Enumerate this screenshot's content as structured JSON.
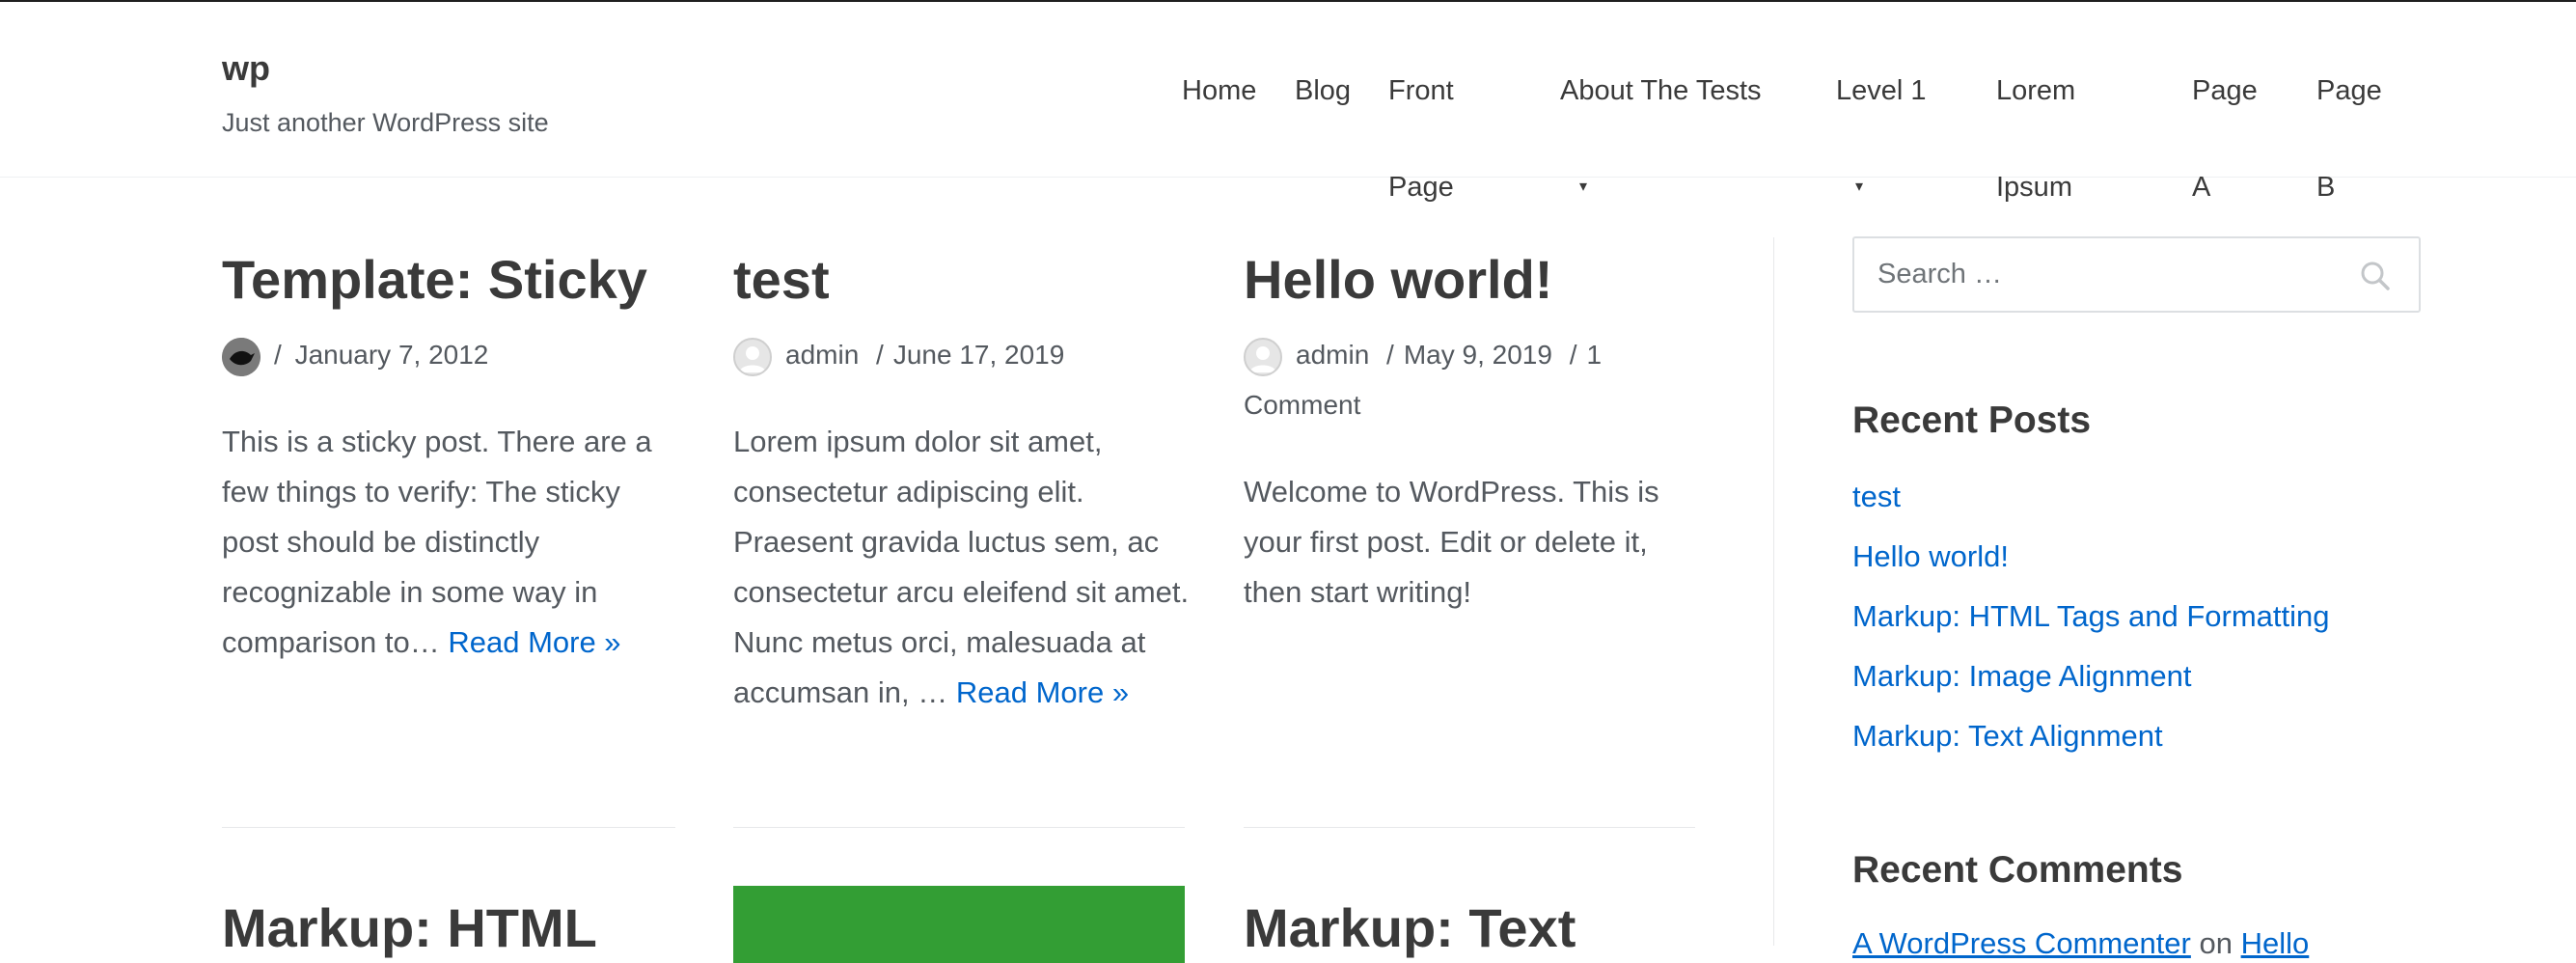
{
  "site": {
    "title": "wp",
    "tagline": "Just another WordPress site"
  },
  "nav": [
    {
      "line1": "Home"
    },
    {
      "line1": "Blog"
    },
    {
      "line1": "Front",
      "line2": "Page",
      "dropdown": true
    },
    {
      "line1": "About The Tests"
    },
    {
      "line1": "Level 1",
      "dropdown": true
    },
    {
      "line1": "Lorem",
      "line2": "Ipsum"
    },
    {
      "line1": "Page",
      "line2": "A"
    },
    {
      "line1": "Page",
      "line2": "B"
    }
  ],
  "posts": [
    {
      "title": "Template: Sticky",
      "author": "",
      "sep": "/",
      "date": "January 7, 2012",
      "excerpt": "This is a sticky post. There are a few things to verify: The sticky post should be distinctly recognizable in some way in comparison to…",
      "read_more": "Read More »"
    },
    {
      "title": "test",
      "author": "admin",
      "sep": "/",
      "date": "June 17, 2019",
      "excerpt": "Lorem ipsum dolor sit amet, consectetur adipiscing elit. Praesent gravida luctus sem, ac consectetur arcu eleifend sit amet. Nunc metus orci, malesuada at accumsan in, …",
      "read_more": "Read More »"
    },
    {
      "title": "Hello world!",
      "author": "admin",
      "sep": "/",
      "date": "May 9, 2019",
      "comments": "1 Comment",
      "excerpt": "Welcome to WordPress. This is your first post. Edit or delete it, then start writing!"
    }
  ],
  "posts_row2": [
    {
      "title": "Markup: HTML"
    },
    {
      "title": ""
    },
    {
      "title": "Markup: Text"
    }
  ],
  "sidebar": {
    "search_placeholder": "Search …",
    "recent_posts_title": "Recent Posts",
    "recent_posts": [
      "test",
      "Hello world!",
      "Markup: HTML Tags and Formatting",
      "Markup: Image Alignment",
      "Markup: Text Alignment"
    ],
    "recent_comments_title": "Recent Comments",
    "recent_comment": {
      "author": "A WordPress Commenter",
      "on": "on",
      "post": "Hello"
    }
  },
  "colors": {
    "link": "#0066cc",
    "heading": "#3a3a3a",
    "text": "#54595f",
    "featured_image": "#339e34"
  }
}
